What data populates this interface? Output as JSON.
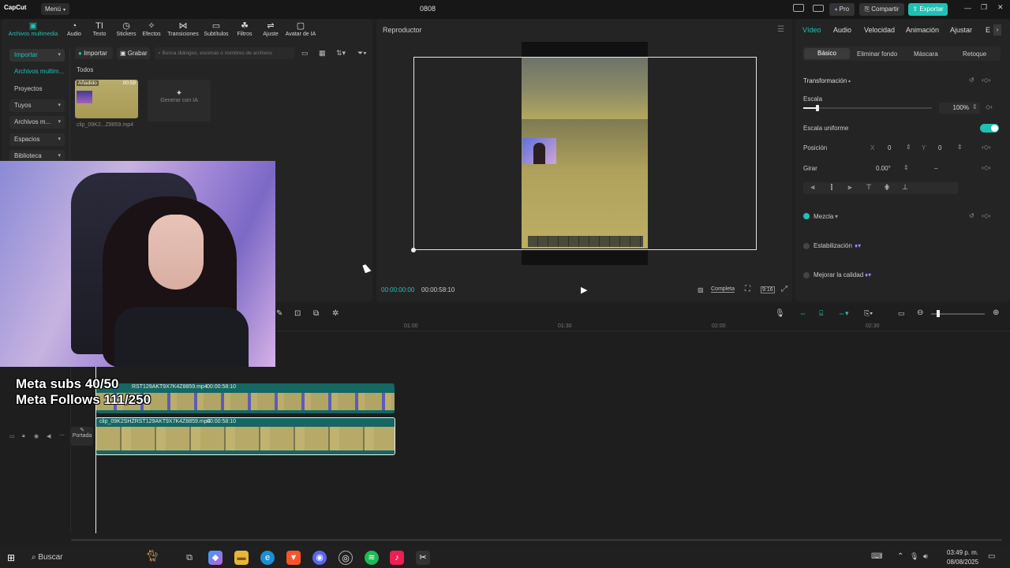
{
  "titlebar": {
    "logo": "CapCut",
    "menu": "Menú",
    "project": "0808",
    "pro": "Pro",
    "share": "Compartir",
    "export": "Exportar"
  },
  "media_tabs": [
    {
      "icon": "media-icon",
      "label": "Archivos multimedia"
    },
    {
      "icon": "audio-icon",
      "label": "Audio"
    },
    {
      "icon": "text-icon",
      "label": "Texto"
    },
    {
      "icon": "sticker-icon",
      "label": "Stickers"
    },
    {
      "icon": "effects-icon",
      "label": "Efectos"
    },
    {
      "icon": "transitions-icon",
      "label": "Transiciones"
    },
    {
      "icon": "subtitles-icon",
      "label": "Subtítulos"
    },
    {
      "icon": "filters-icon",
      "label": "Filtros"
    },
    {
      "icon": "adjust-icon",
      "label": "Ajuste"
    },
    {
      "icon": "ai-avatar-icon",
      "label": "Avatar de IA"
    }
  ],
  "sidebar": {
    "items": [
      "Importar",
      "Archivos multim...",
      "Proyectos secun...",
      "Tuyos",
      "Archivos m...",
      "Espacios",
      "Biblioteca"
    ]
  },
  "media": {
    "import_btn": "Importar",
    "record_btn": "Grabar",
    "search_placeholder": "Busca diálogos, escenas o nombres de archivos",
    "filter_label": "Todos",
    "clip_badge": "Añadido",
    "clip_duration": "00:59",
    "clip_name": "clip_09K2...Z8859.mp4",
    "ai_generate": "Generar con IA"
  },
  "player": {
    "title": "Reproductor",
    "time_current": "00:00:00:00",
    "time_total": "00:00:58:10",
    "quality": "Completa",
    "ratio": "9:16"
  },
  "inspector": {
    "tabs": [
      "Vídeo",
      "Audio",
      "Velocidad",
      "Animación",
      "Ajustar",
      "E"
    ],
    "subtabs": [
      "Básico",
      "Eliminar fondo",
      "Máscara",
      "Retoque"
    ],
    "transform": "Transformación",
    "scale_label": "Escala",
    "scale_value": "100%",
    "uniform_label": "Escala uniforme",
    "position_label": "Posición",
    "x_label": "X",
    "x_value": "0",
    "y_label": "Y",
    "y_value": "0",
    "rotate_label": "Girar",
    "rotate_value": "0.00°",
    "rotate_dash": "–",
    "blend": "Mezcla",
    "stabilize": "Estabilización",
    "quality_improve": "Mejorar la calidad",
    "scale_level": 0.1
  },
  "timeline": {
    "ruler": [
      "01:00",
      "01:30",
      "02:00",
      "02:30"
    ],
    "clip1_name": "RST129AKT9X7K4Z8859.mp4",
    "clip1_duration": "00:00:58:10",
    "clip2_name": "clip_09K2SHZRST129AKT9X7K4Z8859.mp4",
    "clip2_duration": "00:00:58:10",
    "cover": "Portada"
  },
  "overlay": {
    "subs": "Meta subs 40/50",
    "follows": "Meta Follows 111/250"
  },
  "taskbar": {
    "search": "Buscar",
    "time": "03:49 p. m.",
    "date": "08/08/2025"
  },
  "colors": {
    "accent": "#1fc1b4",
    "bg": "#1f1f1f",
    "panel": "#242424"
  }
}
